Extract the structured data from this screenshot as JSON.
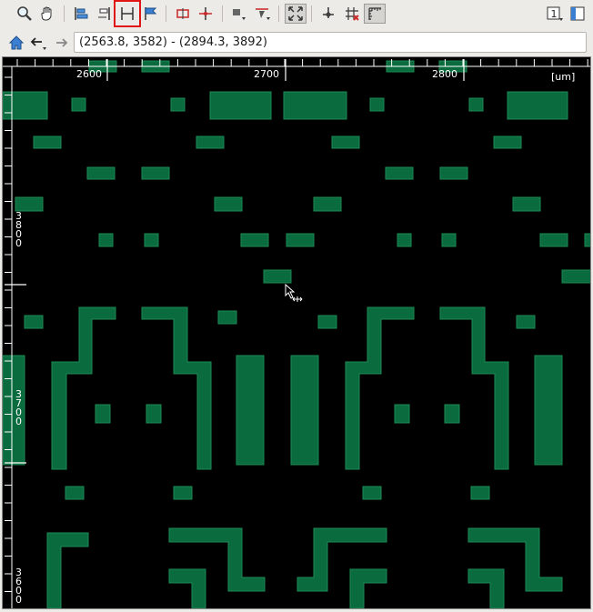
{
  "toolbar": {
    "buttons": [
      {
        "name": "zoom-tool-button",
        "icon": "magnifier-icon"
      },
      {
        "name": "pan-tool-button",
        "icon": "hand-icon"
      },
      {
        "name": "align-left-button",
        "icon": "align-left-icon"
      },
      {
        "name": "align-center-button",
        "icon": "align-center-icon"
      },
      {
        "name": "ruler-button",
        "icon": "ruler-icon",
        "highlighted": true
      },
      {
        "name": "flag-button",
        "icon": "flag-icon"
      },
      {
        "name": "measure-button",
        "icon": "measure-icon"
      },
      {
        "name": "cursor-probe-button",
        "icon": "probe-icon"
      },
      {
        "name": "layer-select-button",
        "icon": "layer-select-icon"
      },
      {
        "name": "layer-filter-button",
        "icon": "layer-filter-icon"
      },
      {
        "name": "fit-view-button",
        "icon": "fit-view-icon",
        "active": true
      },
      {
        "name": "origin-button",
        "icon": "origin-icon"
      },
      {
        "name": "grid-clear-button",
        "icon": "grid-clear-icon"
      },
      {
        "name": "ruler-toggle-button",
        "icon": "ruler-toggle-icon",
        "active": true
      },
      {
        "name": "page-number-button",
        "icon": "page-number-icon",
        "text": "1"
      },
      {
        "name": "panel-toggle-button",
        "icon": "panel-icon"
      }
    ]
  },
  "nav": {
    "coords": "(2563.8, 3582) - (2894.3, 3892)"
  },
  "canvas": {
    "background": "#000000",
    "shape_fill": "#0a6b3e",
    "shape_stroke": "#1e8a55",
    "unit_label": "[um]",
    "x_ticks": [
      "2600",
      "2700",
      "2800"
    ],
    "y_ticks": [
      "3800",
      "3700",
      "3600"
    ]
  }
}
